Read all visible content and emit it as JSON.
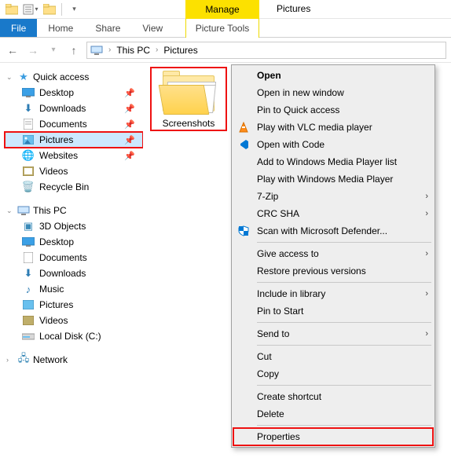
{
  "title": "Pictures",
  "ribbon": {
    "file": "File",
    "tabs": [
      "Home",
      "Share",
      "View"
    ],
    "contextual_header": "Manage",
    "contextual_tab": "Picture Tools"
  },
  "breadcrumb": {
    "segments": [
      "This PC",
      "Pictures"
    ]
  },
  "sidebar": {
    "quick_access": {
      "label": "Quick access",
      "items": [
        {
          "label": "Desktop",
          "pinned": true
        },
        {
          "label": "Downloads",
          "pinned": true
        },
        {
          "label": "Documents",
          "pinned": true
        },
        {
          "label": "Pictures",
          "pinned": true,
          "selected": true,
          "highlight": true
        },
        {
          "label": "Websites",
          "pinned": true
        },
        {
          "label": "Videos",
          "pinned": false
        },
        {
          "label": "Recycle Bin",
          "pinned": false
        }
      ]
    },
    "this_pc": {
      "label": "This PC",
      "items": [
        {
          "label": "3D Objects"
        },
        {
          "label": "Desktop"
        },
        {
          "label": "Documents"
        },
        {
          "label": "Downloads"
        },
        {
          "label": "Music"
        },
        {
          "label": "Pictures"
        },
        {
          "label": "Videos"
        },
        {
          "label": "Local Disk (C:)"
        }
      ]
    },
    "network": {
      "label": "Network"
    }
  },
  "content": {
    "folder_name": "Screenshots"
  },
  "context_menu": {
    "items": [
      {
        "label": "Open",
        "bold": true
      },
      {
        "label": "Open in new window"
      },
      {
        "label": "Pin to Quick access"
      },
      {
        "label": "Play with VLC media player",
        "icon": "vlc"
      },
      {
        "label": "Open with Code",
        "icon": "vscode"
      },
      {
        "label": "Add to Windows Media Player list"
      },
      {
        "label": "Play with Windows Media Player"
      },
      {
        "label": "7-Zip",
        "submenu": true
      },
      {
        "label": "CRC SHA",
        "submenu": true
      },
      {
        "label": "Scan with Microsoft Defender...",
        "icon": "defender"
      },
      {
        "sep": true
      },
      {
        "label": "Give access to",
        "submenu": true
      },
      {
        "label": "Restore previous versions"
      },
      {
        "sep": true
      },
      {
        "label": "Include in library",
        "submenu": true
      },
      {
        "label": "Pin to Start"
      },
      {
        "sep": true
      },
      {
        "label": "Send to",
        "submenu": true
      },
      {
        "sep": true
      },
      {
        "label": "Cut"
      },
      {
        "label": "Copy"
      },
      {
        "sep": true
      },
      {
        "label": "Create shortcut"
      },
      {
        "label": "Delete"
      },
      {
        "sep": true
      },
      {
        "label": "Properties",
        "highlight": true
      }
    ]
  }
}
